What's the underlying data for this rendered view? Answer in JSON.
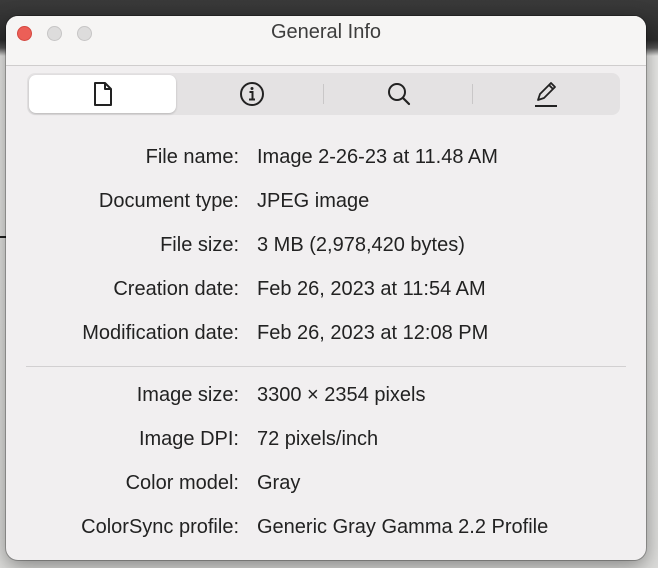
{
  "window": {
    "title": "General Info"
  },
  "tabs": [
    {
      "name": "general",
      "icon": "document-icon",
      "active": true
    },
    {
      "name": "more-info",
      "icon": "info-icon",
      "active": false
    },
    {
      "name": "keywords",
      "icon": "search-icon",
      "active": false
    },
    {
      "name": "annotations",
      "icon": "pencil-icon",
      "active": false
    }
  ],
  "file_info": [
    {
      "label": "File name:",
      "value": "Image 2-26-23 at 11.48 AM"
    },
    {
      "label": "Document type:",
      "value": "JPEG image"
    },
    {
      "label": "File size:",
      "value": "3 MB (2,978,420 bytes)"
    },
    {
      "label": "Creation date:",
      "value": "Feb 26, 2023 at 11:54 AM"
    },
    {
      "label": "Modification date:",
      "value": "Feb 26, 2023 at 12:08 PM"
    }
  ],
  "image_info": [
    {
      "label": "Image size:",
      "value": "3300 × 2354 pixels"
    },
    {
      "label": "Image DPI:",
      "value": "72 pixels/inch"
    },
    {
      "label": "Color model:",
      "value": "Gray"
    },
    {
      "label": "ColorSync profile:",
      "value": "Generic Gray Gamma 2.2 Profile"
    }
  ],
  "colors": {
    "close": "#ec5f57",
    "inactive": "#dddcdc"
  }
}
